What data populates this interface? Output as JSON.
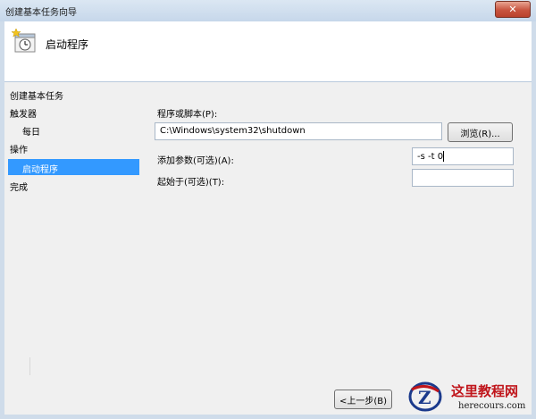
{
  "window": {
    "title": "创建基本任务向导",
    "close_icon": "close-icon"
  },
  "header": {
    "title": "启动程序",
    "icon": "scheduled-task-icon"
  },
  "nav": {
    "items": [
      {
        "label": "创建基本任务",
        "selected": false
      },
      {
        "label": "触发器",
        "selected": false
      },
      {
        "label": "每日",
        "selected": false
      },
      {
        "label": "操作",
        "selected": false
      },
      {
        "label": "启动程序",
        "selected": true
      },
      {
        "label": "完成",
        "selected": false
      }
    ]
  },
  "form": {
    "program_label": "程序或脚本(P):",
    "program_value": "C:\\Windows\\system32\\shutdown",
    "browse_label": "浏览(R)...",
    "args_label": "添加参数(可选)(A):",
    "args_value": "-s -t 0",
    "startin_label": "起始于(可选)(T):",
    "startin_value": ""
  },
  "buttons": {
    "back_label": "<上一步(B)"
  },
  "watermark": {
    "name": "这里教程网",
    "url": "herecours.com"
  },
  "colors": {
    "selection": "#3399ff",
    "close": "#c8543f",
    "watermark_red": "#c0161c"
  }
}
